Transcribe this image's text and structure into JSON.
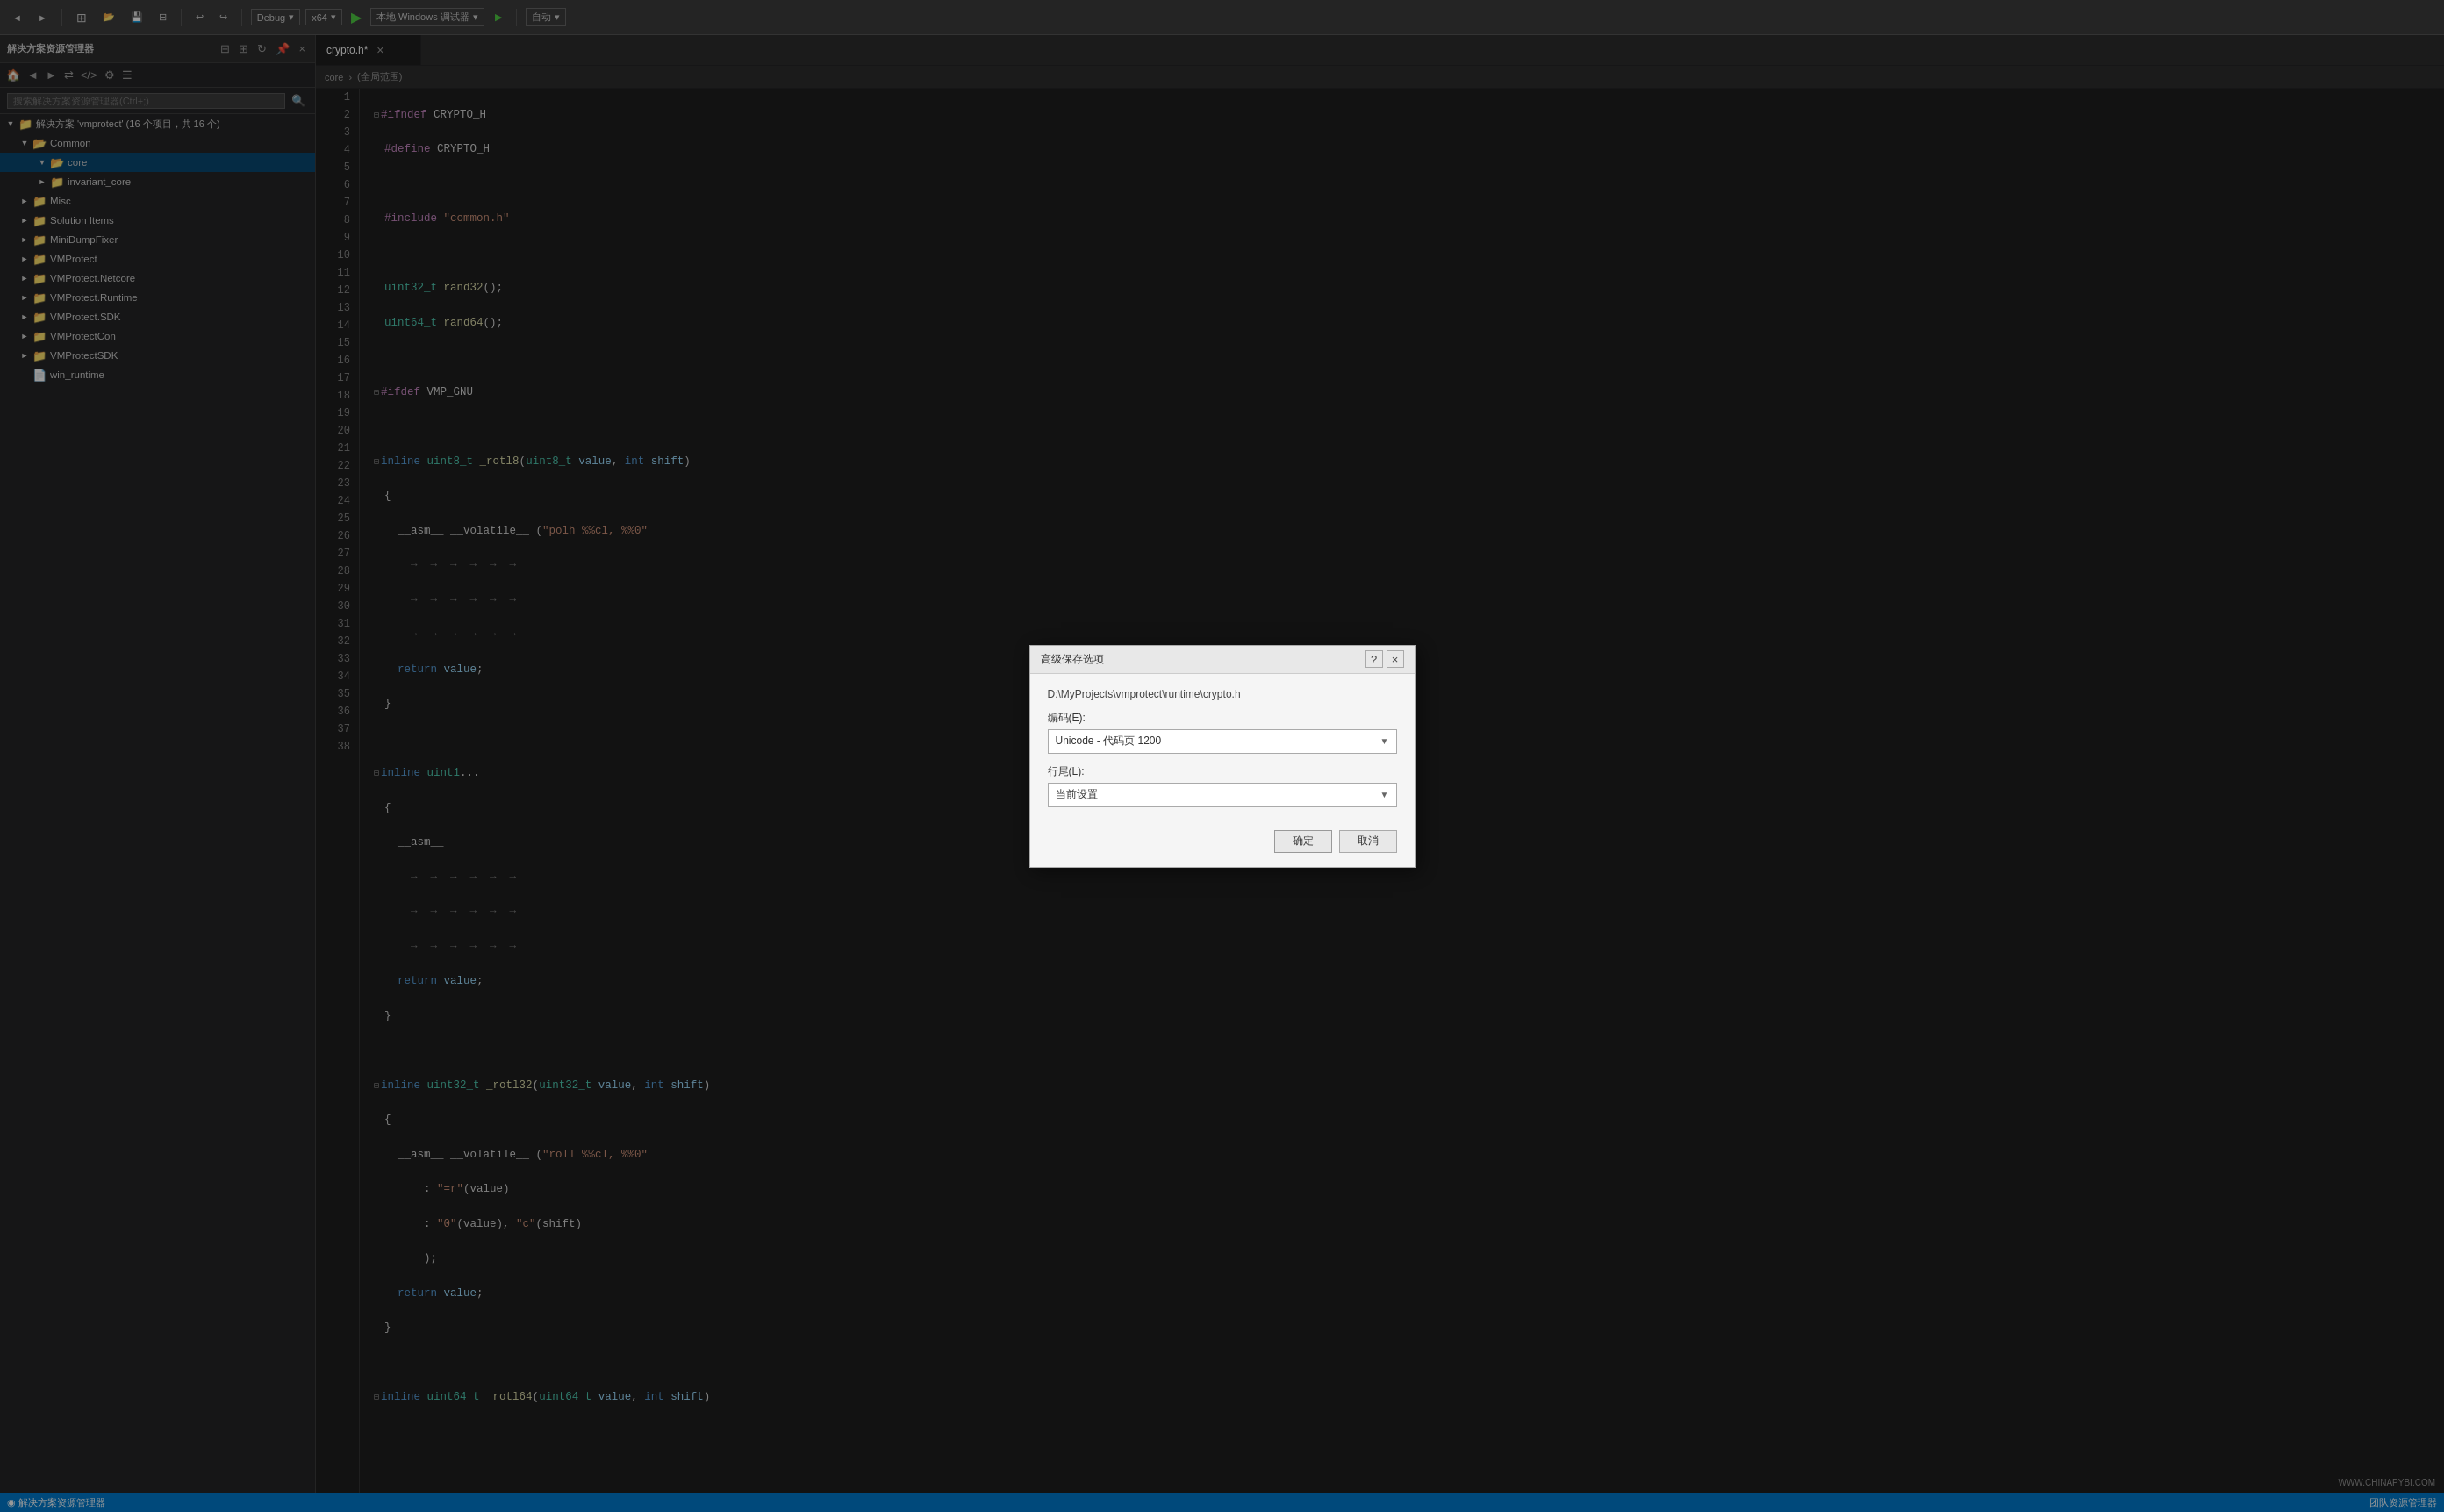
{
  "app": {
    "title": "解决方案资源管理器"
  },
  "toolbar": {
    "debug_label": "Debug",
    "platform_label": "x64",
    "run_label": "本地 Windows 调试器",
    "auto_label": "自动",
    "chevron": "▾"
  },
  "sidebar": {
    "title": "解决方案资源管理器",
    "search_placeholder": "搜索解决方案资源管理器(Ctrl+;)",
    "solution_label": "解决方案 'vmprotect' (16 个项目，共 16 个)",
    "items": [
      {
        "name": "Common",
        "level": 1,
        "type": "folder",
        "expanded": true
      },
      {
        "name": "core",
        "level": 2,
        "type": "folder",
        "expanded": true
      },
      {
        "name": "invariant_core",
        "level": 2,
        "type": "folder",
        "expanded": false
      },
      {
        "name": "Misc",
        "level": 1,
        "type": "folder",
        "expanded": false
      },
      {
        "name": "Solution Items",
        "level": 1,
        "type": "folder",
        "expanded": false
      },
      {
        "name": "MiniDumpFixer",
        "level": 1,
        "type": "folder",
        "expanded": false
      },
      {
        "name": "VMProtect",
        "level": 1,
        "type": "folder",
        "expanded": false
      },
      {
        "name": "VMProtect.Netcore",
        "level": 1,
        "type": "folder",
        "expanded": false
      },
      {
        "name": "VMProtect.Runtime",
        "level": 1,
        "type": "folder",
        "expanded": false
      },
      {
        "name": "VMProtect.SDK",
        "level": 1,
        "type": "folder",
        "expanded": false
      },
      {
        "name": "VMProtectCon",
        "level": 1,
        "type": "folder",
        "expanded": false
      },
      {
        "name": "VMProtectSDK",
        "level": 1,
        "type": "folder",
        "expanded": false
      },
      {
        "name": "win_runtime",
        "level": 1,
        "type": "file",
        "expanded": false
      }
    ]
  },
  "editor": {
    "tab_name": "crypto.h*",
    "tab_close": "×",
    "path_breadcrumb": "core",
    "path_scope": "(全局范围)",
    "lines": [
      {
        "n": 1,
        "content": "#ifndef CRYPTO_H",
        "type": "prep"
      },
      {
        "n": 2,
        "content": "#define CRYPTO_H",
        "type": "prep"
      },
      {
        "n": 3,
        "content": ""
      },
      {
        "n": 4,
        "content": "#include \"common.h\"",
        "type": "include"
      },
      {
        "n": 5,
        "content": ""
      },
      {
        "n": 6,
        "content": "uint32_t rand32();",
        "type": "code"
      },
      {
        "n": 7,
        "content": "uint64_t rand64();",
        "type": "code"
      },
      {
        "n": 8,
        "content": ""
      },
      {
        "n": 9,
        "content": "#ifdef VMP_GNU",
        "type": "prep"
      },
      {
        "n": 10,
        "content": ""
      },
      {
        "n": 11,
        "content": "inline uint8_t _rotl8(uint8_t value, int shift)",
        "type": "code"
      },
      {
        "n": 12,
        "content": "{",
        "type": "code"
      },
      {
        "n": 13,
        "content": "  __asm__ __volatile__ (\"polh %%cl, %%0\"",
        "type": "collapsed"
      },
      {
        "n": 14,
        "content": "  →  →  →  →  →  →",
        "type": "arrows"
      },
      {
        "n": 15,
        "content": "  →  →  →  →  →  →",
        "type": "arrows"
      },
      {
        "n": 16,
        "content": "  →  →  →  →  →  →",
        "type": "arrows"
      },
      {
        "n": 17,
        "content": "  return value;",
        "type": "code"
      },
      {
        "n": 18,
        "content": "}",
        "type": "code"
      },
      {
        "n": 19,
        "content": ""
      },
      {
        "n": 20,
        "content": "inline uint1...",
        "type": "code"
      },
      {
        "n": 21,
        "content": "{",
        "type": "code"
      },
      {
        "n": 22,
        "content": "  __asm__",
        "type": "code"
      },
      {
        "n": 23,
        "content": "  →  →  →  →  →  →",
        "type": "arrows"
      },
      {
        "n": 24,
        "content": "  →  →  →  →  →  →",
        "type": "arrows"
      },
      {
        "n": 25,
        "content": "  →  →  →  →  →  →",
        "type": "arrows"
      },
      {
        "n": 26,
        "content": "  return value;",
        "type": "code"
      },
      {
        "n": 27,
        "content": "}",
        "type": "code"
      },
      {
        "n": 28,
        "content": ""
      },
      {
        "n": 29,
        "content": "inline uint32_t _rotl32(uint32_t value, int shift)",
        "type": "code"
      },
      {
        "n": 30,
        "content": "{",
        "type": "code"
      },
      {
        "n": 31,
        "content": "  __asm__ __volatile__ (\"roll %%cl, %%0\"",
        "type": "code"
      },
      {
        "n": 32,
        "content": "      : \"=r\"(value)",
        "type": "code"
      },
      {
        "n": 33,
        "content": "      : \"0\"(value), \"c\"(shift)",
        "type": "code"
      },
      {
        "n": 34,
        "content": "      );",
        "type": "code"
      },
      {
        "n": 35,
        "content": "  return value;",
        "type": "code"
      },
      {
        "n": 36,
        "content": "}",
        "type": "code"
      },
      {
        "n": 37,
        "content": ""
      },
      {
        "n": 38,
        "content": "inline uint64_t _rotl64(uint64_t value, int shift)",
        "type": "code"
      }
    ]
  },
  "modal": {
    "title": "高级保存选项",
    "file_path": "D:\\MyProjects\\vmprotect\\runtime\\crypto.h",
    "encoding_label": "编码(E):",
    "encoding_value": "Unicode - 代码页 1200",
    "line_ending_label": "行尾(L):",
    "line_ending_value": "当前设置",
    "ok_label": "确定",
    "cancel_label": "取消",
    "help_btn": "?",
    "close_btn": "×"
  },
  "statusbar": {
    "left": "◉ 解决方案资源管理器",
    "right_team": "团队资源管理器",
    "watermark": "WWW.CHINAPYBI.COM"
  }
}
